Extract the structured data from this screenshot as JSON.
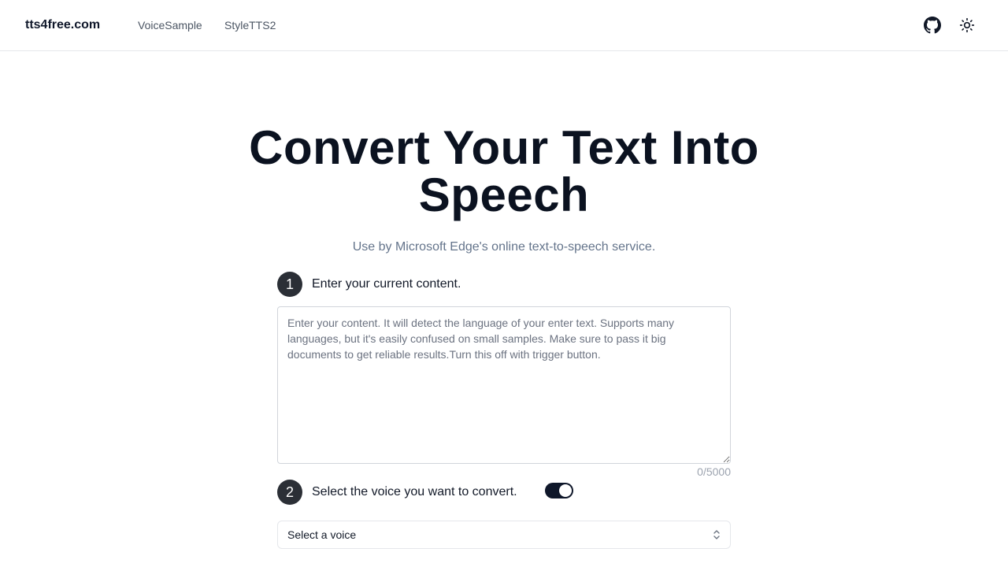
{
  "header": {
    "brand": "tts4free.com",
    "nav": [
      "VoiceSample",
      "StyleTTS2"
    ],
    "icons": [
      "github-icon",
      "sun-icon"
    ]
  },
  "hero": {
    "title": "Convert Your Text Into Speech",
    "subtitle": "Use by Microsoft Edge's online text-to-speech service."
  },
  "steps": [
    {
      "number": "1",
      "label": "Enter your current content."
    },
    {
      "number": "2",
      "label": "Select the voice you want to convert."
    }
  ],
  "content_input": {
    "value": "",
    "placeholder": "Enter your content. It will detect the language of your enter text. Supports many languages, but it's easily confused on small samples. Make sure to pass it big documents to get reliable results.Turn this off with trigger button.",
    "char_count": "0/5000"
  },
  "language_detect_toggle": {
    "on": true
  },
  "voice_select": {
    "selected": "Select a voice"
  },
  "colors": {
    "text_dark": "#0f172a",
    "muted": "#64748b",
    "step_circle": "#2b2f36",
    "toggle_on": "#0f172a"
  }
}
